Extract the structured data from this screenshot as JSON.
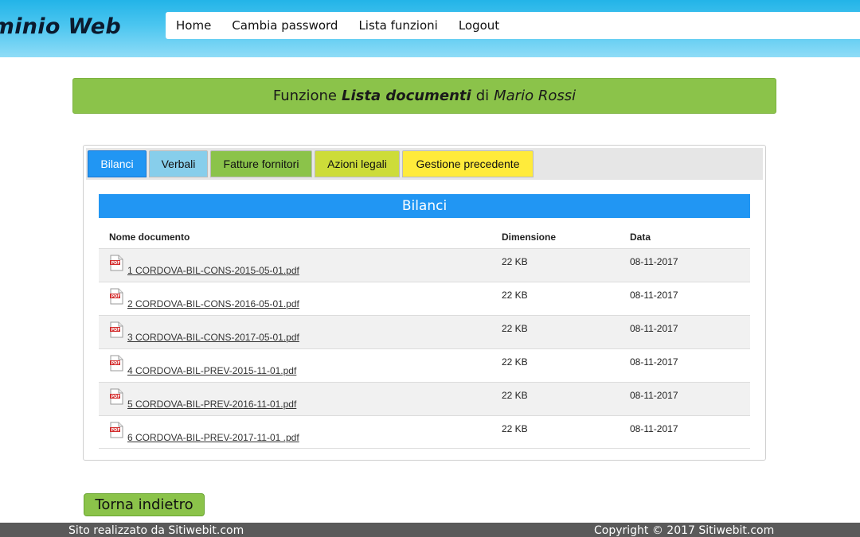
{
  "header": {
    "brand": "Condominio Web",
    "nav": [
      "Home",
      "Cambia password",
      "Lista funzioni",
      "Logout"
    ]
  },
  "banner": {
    "prefix": "Funzione",
    "function_name": "Lista documenti",
    "connector": "di",
    "user": "Mario Rossi"
  },
  "tabs": [
    "Bilanci",
    "Verbali",
    "Fatture fornitori",
    "Azioni legali",
    "Gestione precedente"
  ],
  "section": {
    "title": "Bilanci"
  },
  "table": {
    "headers": {
      "name": "Nome documento",
      "size": "Dimensione",
      "date": "Data"
    },
    "rows": [
      {
        "name": "1 CORDOVA-BIL-CONS-2015-05-01.pdf",
        "size": "22 KB",
        "date": "08-11-2017"
      },
      {
        "name": "2 CORDOVA-BIL-CONS-2016-05-01.pdf",
        "size": "22 KB",
        "date": "08-11-2017"
      },
      {
        "name": "3 CORDOVA-BIL-CONS-2017-05-01.pdf",
        "size": "22 KB",
        "date": "08-11-2017"
      },
      {
        "name": "4 CORDOVA-BIL-PREV-2015-11-01.pdf",
        "size": "22 KB",
        "date": "08-11-2017"
      },
      {
        "name": "5 CORDOVA-BIL-PREV-2016-11-01.pdf",
        "size": "22 KB",
        "date": "08-11-2017"
      },
      {
        "name": "6 CORDOVA-BIL-PREV-2017-11-01 .pdf",
        "size": "22 KB",
        "date": "08-11-2017"
      }
    ],
    "file_icon": "pdf-file-icon"
  },
  "back_button": {
    "label": "Torna indietro"
  },
  "footer": {
    "left": "Sito realizzato da Sitiwebit.com",
    "right": "Copyright © 2017 Sitiwebit.com"
  },
  "colors": {
    "primary_blue": "#2196f3",
    "green": "#8bc34a",
    "light_blue": "#87ceeb",
    "lime": "#cddc39",
    "yellow": "#ffeb3b",
    "footer_gray": "#5a5a5a"
  }
}
